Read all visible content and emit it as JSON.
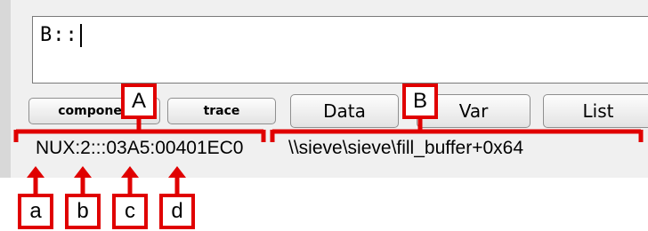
{
  "command_line": {
    "value": "B::"
  },
  "buttons": [
    {
      "label": "componen"
    },
    {
      "label": "trace"
    },
    {
      "label": "Data"
    },
    {
      "label": "Var"
    },
    {
      "label": "List"
    }
  ],
  "status": {
    "address": "NUX:2:::03A5:00401EC0",
    "symbol": "\\\\sieve\\sieve\\fill_buffer+0x64"
  },
  "callouts": {
    "A": "A",
    "B": "B",
    "a": "a",
    "b": "b",
    "c": "c",
    "d": "d"
  },
  "colors": {
    "callout_red": "#e00000",
    "window_bg": "#f0f0f0"
  }
}
